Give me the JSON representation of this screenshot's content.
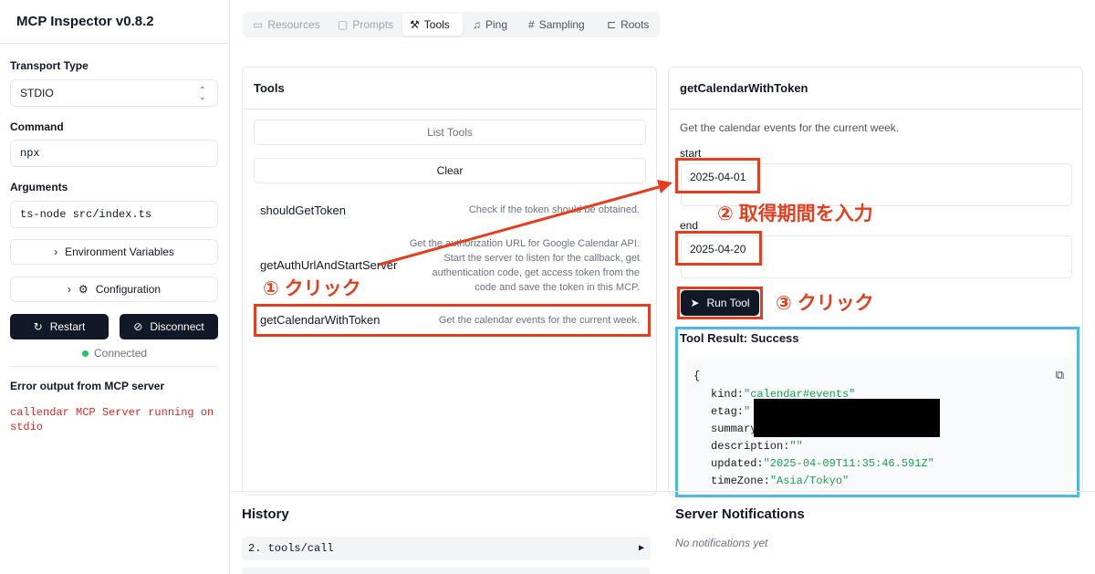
{
  "app": {
    "title": "MCP Inspector v0.8.2"
  },
  "sidebar": {
    "transport_label": "Transport Type",
    "transport_value": "STDIO",
    "command_label": "Command",
    "command_value": "npx",
    "arguments_label": "Arguments",
    "arguments_value": "ts-node src/index.ts",
    "env_button": "Environment Variables",
    "config_button": "Configuration",
    "restart_button": "Restart",
    "disconnect_button": "Disconnect",
    "status": "Connected",
    "error_title": "Error output from MCP server",
    "error_lines": [
      "callendar MCP Server running on",
      "stdio"
    ]
  },
  "tabs": [
    {
      "label": "Resources",
      "icon": "folder-icon"
    },
    {
      "label": "Prompts",
      "icon": "chat-icon"
    },
    {
      "label": "Tools",
      "icon": "hammer-icon"
    },
    {
      "label": "Ping",
      "icon": "bell-icon"
    },
    {
      "label": "Sampling",
      "icon": "hash-icon"
    },
    {
      "label": "Roots",
      "icon": "tree-icon"
    }
  ],
  "tools_panel": {
    "title": "Tools",
    "list_button": "List Tools",
    "clear_button": "Clear",
    "tools": [
      {
        "name": "shouldGetToken",
        "desc_lines": [
          "Check if the token should be obtained."
        ]
      },
      {
        "name": "getAuthUrlAndStartServer",
        "desc_lines": [
          "Get the authorization URL for Google Calendar API.",
          "Start the server to listen for the callback, get",
          "authentication code, get access token from the",
          "code and save the token in this MCP."
        ]
      },
      {
        "name": "getCalendarWithToken",
        "desc_lines": [
          "Get the calendar events for the current week."
        ]
      }
    ]
  },
  "detail_panel": {
    "title": "getCalendarWithToken",
    "description": "Get the calendar events for the current week.",
    "start_label": "start",
    "start_value": "2025-04-01",
    "end_label": "end",
    "end_value": "2025-04-20",
    "run_button": "Run Tool",
    "result_title": "Tool Result: Success",
    "result": {
      "open_brace": "{",
      "lines": [
        {
          "key": "kind:",
          "value": "\"calendar#events\""
        },
        {
          "key": "etag:",
          "value": "\""
        },
        {
          "key": "summary",
          "value": ""
        },
        {
          "key": "description:",
          "value": "\"\""
        },
        {
          "key": "updated:",
          "value": "\"2025-04-09T11:35:46.591Z\""
        },
        {
          "key": "timeZone:",
          "value": "\"Asia/Tokyo\""
        }
      ]
    }
  },
  "annotations": {
    "step1": "① クリック",
    "step2": "② 取得期間を入力",
    "step3": "③ クリック",
    "red": "#e53e1e",
    "blue": "#4ab8e8"
  },
  "history": {
    "title": "History",
    "items": [
      {
        "label": "2. tools/call",
        "arrow": "▶"
      }
    ]
  },
  "notifications": {
    "title": "Server Notifications",
    "empty": "No notifications yet"
  }
}
